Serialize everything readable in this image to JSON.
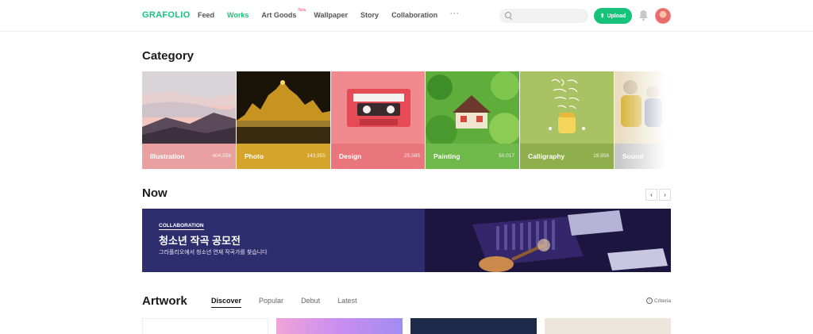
{
  "header": {
    "logo": "GRAFOLIO",
    "nav": [
      {
        "label": "Feed",
        "active": false
      },
      {
        "label": "Works",
        "active": true
      },
      {
        "label": "Art Goods",
        "badge": "New",
        "active": false
      },
      {
        "label": "Wallpaper",
        "active": false
      },
      {
        "label": "Story",
        "active": false
      },
      {
        "label": "Collaboration",
        "active": false
      }
    ],
    "more_label": "···",
    "search_placeholder": "",
    "upload_label": "Upload",
    "accent_color": "#17c37b"
  },
  "category": {
    "title": "Category",
    "items": [
      {
        "name": "Illustration",
        "count": "404,558",
        "color": "#e8a0a0"
      },
      {
        "name": "Photo",
        "count": "143,955",
        "color": "#d4a42b"
      },
      {
        "name": "Design",
        "count": "25,585",
        "color": "#e8767c"
      },
      {
        "name": "Painting",
        "count": "50,017",
        "color": "#6fb84a"
      },
      {
        "name": "Calligraphy",
        "count": "19,956",
        "color": "#8fae4c"
      },
      {
        "name": "Sound",
        "count": "",
        "color": "#c9c9c9"
      }
    ]
  },
  "now": {
    "title": "Now",
    "prev_label": "‹",
    "next_label": "›",
    "banner": {
      "kicker": "COLLABORATION",
      "title": "청소년 작곡 공모전",
      "desc": "그라폴리오에서 청소년 연재 작곡가를 찾습니다"
    }
  },
  "artwork": {
    "title": "Artwork",
    "tabs": [
      {
        "label": "Discover",
        "active": true
      },
      {
        "label": "Popular",
        "active": false
      },
      {
        "label": "Debut",
        "active": false
      },
      {
        "label": "Latest",
        "active": false
      }
    ],
    "criteria_label": "Criteria"
  }
}
